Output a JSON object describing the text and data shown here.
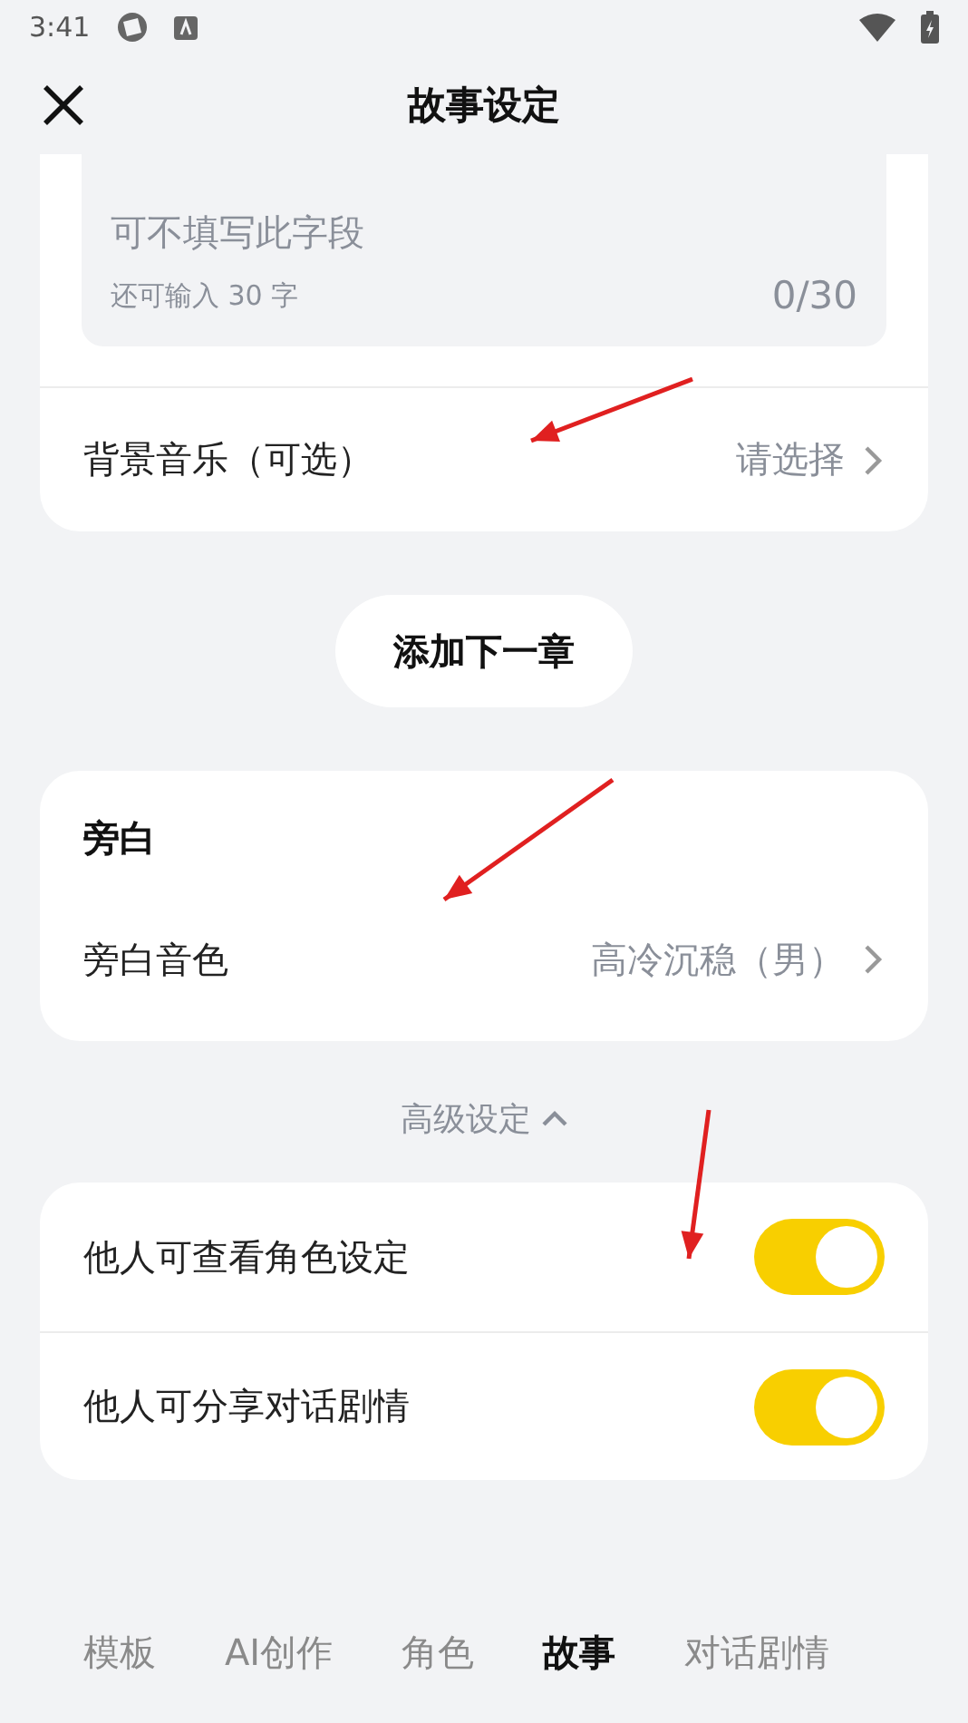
{
  "status_bar": {
    "time": "3:41"
  },
  "header": {
    "title": "故事设定"
  },
  "description_field": {
    "placeholder": "可不填写此字段",
    "hint": "还可输入 30 字",
    "counter": "0/30"
  },
  "music_row": {
    "label": "背景音乐（可选）",
    "value": "请选择"
  },
  "add_chapter_button": "添加下一章",
  "narration": {
    "title": "旁白",
    "row": {
      "label": "旁白音色",
      "value": "高冷沉稳（男）"
    }
  },
  "advanced": {
    "label": "高级设定",
    "expanded": true
  },
  "toggles": [
    {
      "label": "他人可查看角色设定",
      "on": true
    },
    {
      "label": "他人可分享对话剧情",
      "on": true
    }
  ],
  "bottom_tabs": [
    {
      "label": "模板",
      "selected": false
    },
    {
      "label": "AI创作",
      "selected": false
    },
    {
      "label": "角色",
      "selected": false
    },
    {
      "label": "故事",
      "selected": true
    },
    {
      "label": "对话剧情",
      "selected": false
    }
  ]
}
